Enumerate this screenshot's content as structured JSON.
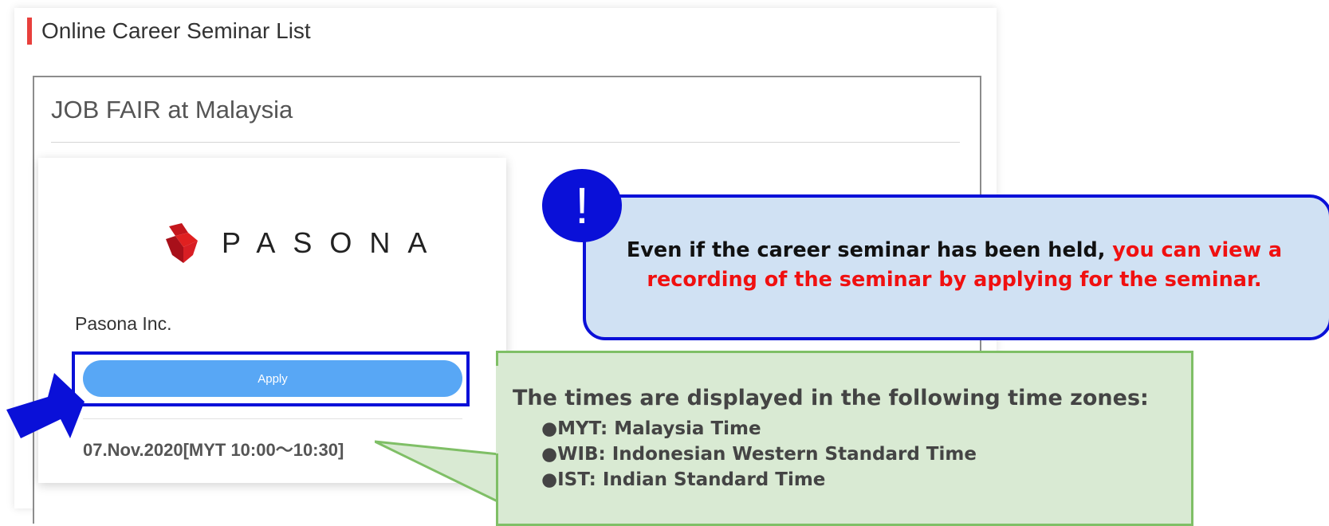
{
  "page": {
    "section_title": "Online Career Seminar List",
    "fair_title": "JOB FAIR at Malaysia"
  },
  "company": {
    "logo_text": "PASONA",
    "name": "Pasona Inc.",
    "apply_label": "Apply",
    "seminar_date": "07.Nov.2020[MYT 10:00〜10:30]"
  },
  "callout_info": {
    "icon": "!",
    "text_plain": "Even if the career seminar has been held, ",
    "text_highlight": "you can view a recording of the seminar by applying for the seminar."
  },
  "callout_timezones": {
    "heading": "The times are displayed in the following time zones:",
    "items": [
      "●MYT: Malaysia Time",
      "●WIB: Indonesian Western Standard Time",
      "●IST: Indian Standard Time"
    ]
  },
  "colors": {
    "accent_red": "#e8403c",
    "highlight_blue": "#0a10d8",
    "button_blue": "#58a7f5",
    "callout_blue_bg": "#d0e1f3",
    "callout_green_bg": "#d9ead3",
    "callout_green_border": "#7fbf66",
    "emphasis_red": "#f01010"
  },
  "icons": {
    "pointer": "blue-arrow-icon",
    "notice": "exclamation-icon",
    "logo": "pasona-logo-icon"
  }
}
